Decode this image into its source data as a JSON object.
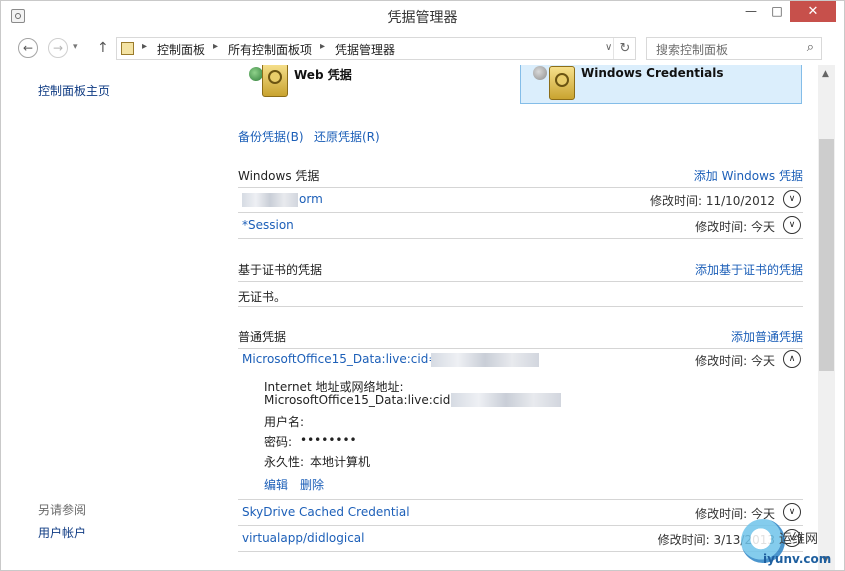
{
  "window": {
    "title": "凭据管理器",
    "minimize": "—",
    "maximize": "□",
    "close": "✕"
  },
  "nav": {
    "back": "←",
    "forward": "→",
    "up": "↑",
    "history": "▾",
    "breadcrumb": [
      "控制面板",
      "所有控制面板项",
      "凭据管理器"
    ],
    "separator": "▸",
    "refresh": "↻",
    "dropdown": "∨",
    "search_placeholder": "搜索控制面板",
    "search_icon": "⌕"
  },
  "left_pane": {
    "home_link": "控制面板主页",
    "see_also": "另请参阅",
    "user_accounts": "用户帐户"
  },
  "tiles": {
    "web_label": "Web 凭据",
    "windows_label": "Windows Credentials"
  },
  "actions": {
    "backup": "备份凭据(B)",
    "restore": "还原凭据(R)"
  },
  "sections": {
    "windows": {
      "title": "Windows 凭据",
      "add": "添加 Windows 凭据",
      "rows": [
        {
          "name": "orm",
          "time": "修改时间:  11/10/2012"
        },
        {
          "name": "*Session",
          "time": "修改时间:  今天"
        }
      ]
    },
    "cert": {
      "title": "基于证书的凭据",
      "add": "添加基于证书的凭据",
      "empty": "无证书。"
    },
    "generic": {
      "title": "普通凭据",
      "add": "添加普通凭据",
      "expanded": {
        "name": "MicrosoftOffice15_Data:live:cid=",
        "time": "修改时间:  今天",
        "address_label": "Internet 地址或网络地址:",
        "address_value": "MicrosoftOffice15_Data:live:cid=",
        "username_label": "用户名:",
        "password_label": "密码:",
        "password_value": "••••••••",
        "persistence_label": "永久性:",
        "persistence_value": "本地计算机",
        "edit": "编辑",
        "delete": "删除"
      },
      "rows": [
        {
          "name": "SkyDrive Cached Credential",
          "time": "修改时间:  今天"
        },
        {
          "name": "virtualapp/didlogical",
          "time": "修改时间:  3/13/2013"
        }
      ]
    }
  },
  "chevrons": {
    "down": "∨",
    "up": "∧"
  },
  "scrollbar": {
    "up": "▲",
    "down": "▼"
  },
  "watermark": {
    "top": "运维网",
    "bottom": "iyunv.com"
  }
}
